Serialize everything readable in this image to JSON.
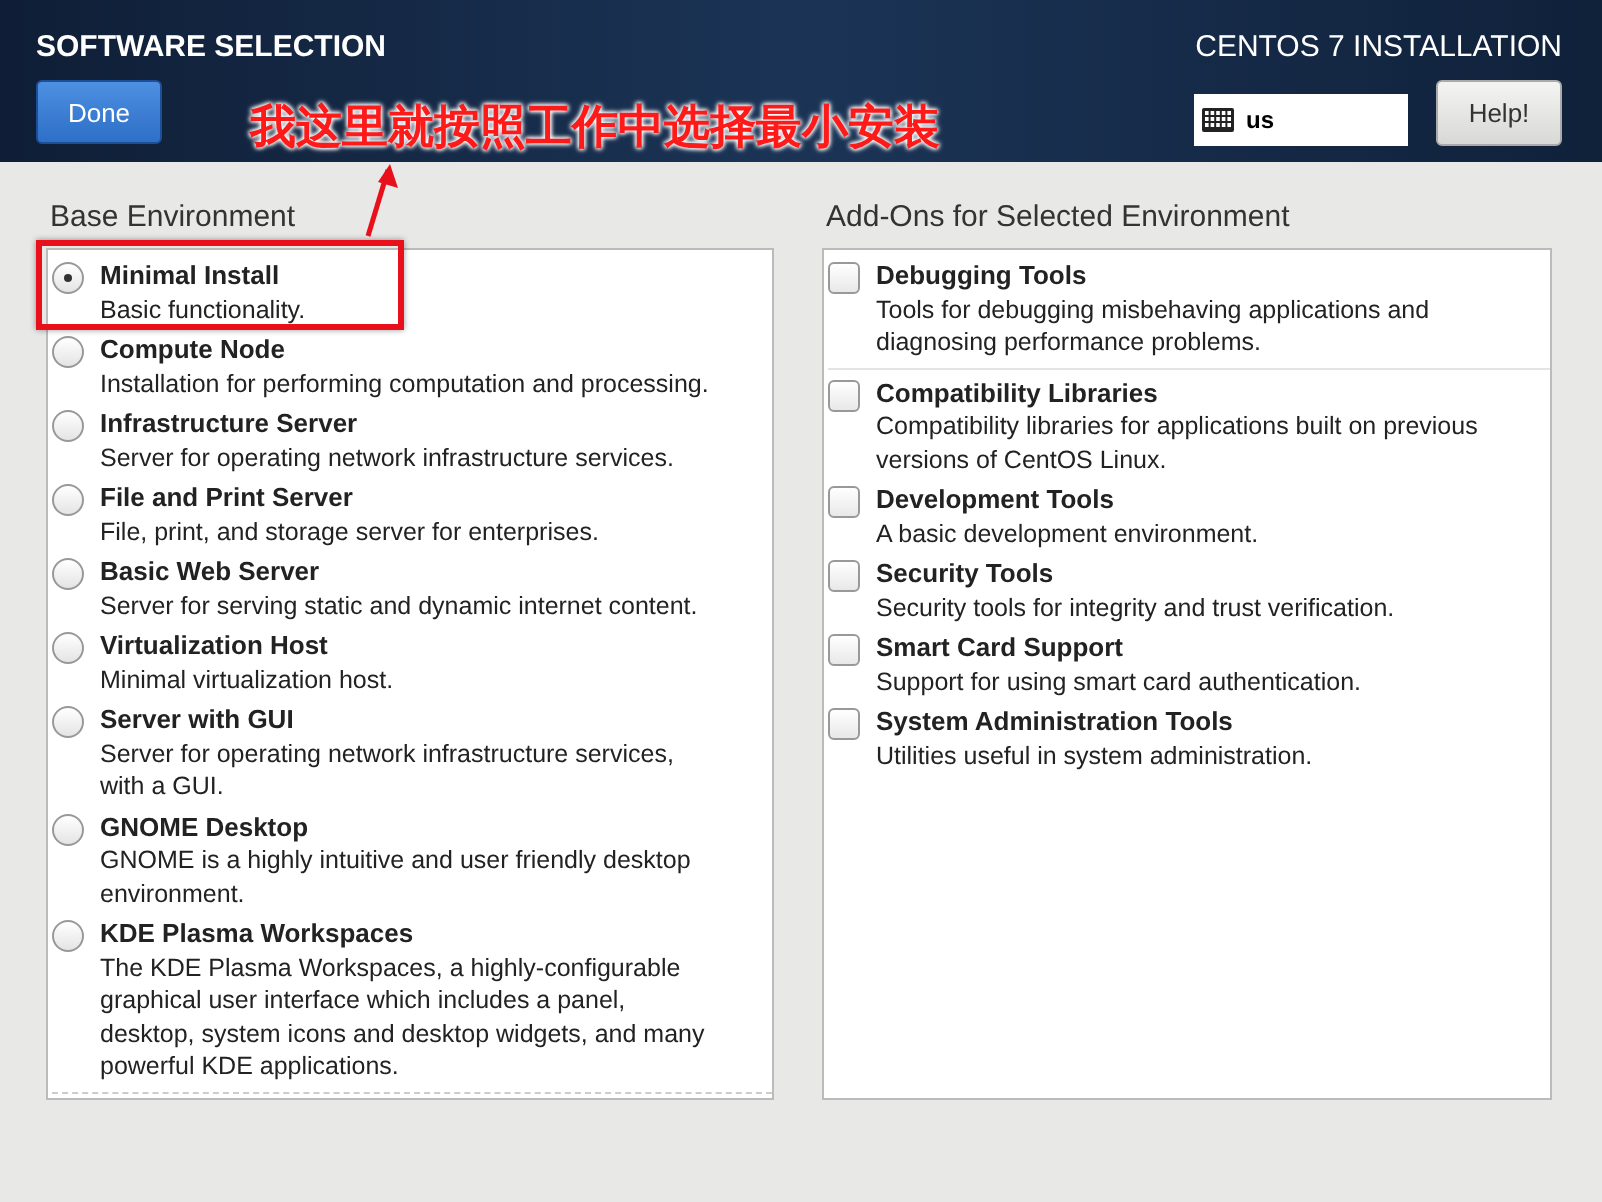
{
  "header": {
    "title": "SOFTWARE SELECTION",
    "done_button": "Done",
    "product": "CENTOS 7 INSTALLATION",
    "keyboard_layout": "us",
    "help_button": "Help!"
  },
  "annotation": {
    "text": "我这里就按照工作中选择最小安装"
  },
  "base_environment": {
    "heading": "Base Environment",
    "items": [
      {
        "name": "Minimal Install",
        "description": "Basic functionality.",
        "selected": true
      },
      {
        "name": "Compute Node",
        "description": "Installation for performing computation and processing.",
        "selected": false
      },
      {
        "name": "Infrastructure Server",
        "description": "Server for operating network infrastructure services.",
        "selected": false
      },
      {
        "name": "File and Print Server",
        "description": "File, print, and storage server for enterprises.",
        "selected": false
      },
      {
        "name": "Basic Web Server",
        "description": "Server for serving static and dynamic internet content.",
        "selected": false
      },
      {
        "name": "Virtualization Host",
        "description": "Minimal virtualization host.",
        "selected": false
      },
      {
        "name": "Server with GUI",
        "description": "Server for operating network infrastructure services, with a GUI.",
        "selected": false
      },
      {
        "name": "GNOME Desktop",
        "description": "GNOME is a highly intuitive and user friendly desktop environment.",
        "selected": false
      },
      {
        "name": "KDE Plasma Workspaces",
        "description": "The KDE Plasma Workspaces, a highly-configurable graphical user interface which includes a panel, desktop, system icons and desktop widgets, and many powerful KDE applications.",
        "selected": false
      }
    ]
  },
  "addons": {
    "heading": "Add-Ons for Selected Environment",
    "items": [
      {
        "name": "Debugging Tools",
        "description": "Tools for debugging misbehaving applications and diagnosing performance problems.",
        "checked": false
      },
      {
        "name": "Compatibility Libraries",
        "description": "Compatibility libraries for applications built on previous versions of CentOS Linux.",
        "checked": false
      },
      {
        "name": "Development Tools",
        "description": "A basic development environment.",
        "checked": false
      },
      {
        "name": "Security Tools",
        "description": "Security tools for integrity and trust verification.",
        "checked": false
      },
      {
        "name": "Smart Card Support",
        "description": "Support for using smart card authentication.",
        "checked": false
      },
      {
        "name": "System Administration Tools",
        "description": "Utilities useful in system administration.",
        "checked": false
      }
    ]
  }
}
